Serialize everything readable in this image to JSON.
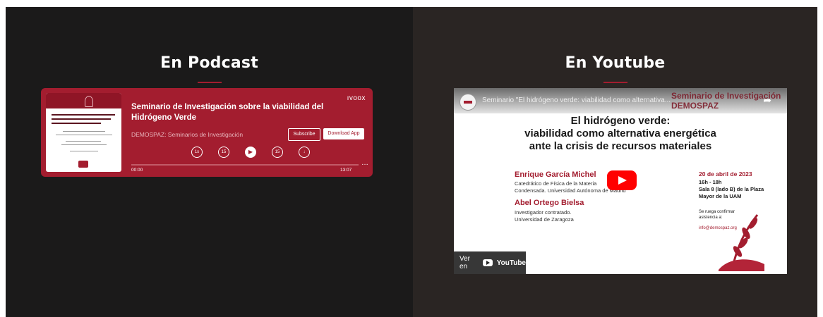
{
  "podcast_section": {
    "heading": "En Podcast",
    "player": {
      "brand": "ıvoox",
      "title": "Seminario de Investigación sobre la viabilidad del Hidrógeno Verde",
      "channel": "DEMOSPAZ: Seminarios de Investigación",
      "subscribe_label": "Subscribe",
      "download_label": "Download App",
      "controls": [
        "1x",
        "15",
        "▶",
        "15",
        "↓"
      ],
      "time_start": "00:00",
      "time_end": "13:07",
      "progress": 0.0,
      "more_icon": "…"
    }
  },
  "youtube_section": {
    "heading": "En Youtube",
    "video": {
      "top_title": "Seminario \"El hidrógeno verde: viabilidad como alternativa...",
      "badge": "Seminario de Investigación DEMOSPAZ",
      "main_title_line1": "El hidrógeno verde:",
      "main_title_line2": "viabilidad como alternativa energética",
      "main_title_line3": "ante la crisis de recursos materiales",
      "speaker1_name": "Enrique García Michel",
      "speaker1_desc_line1": "Catedrático de Física de la Materia",
      "speaker1_desc_line2": "Condensada. Universidad Autónoma de Madrid",
      "speaker2_name": "Abel Ortego Bielsa",
      "speaker2_desc_line1": "Investigador contratado.",
      "speaker2_desc_line2": "Universidad de Zaragoza",
      "date": "20 de abril de 2023",
      "info_line1": "16h - 18h",
      "info_line2": "Sala 8 (lado B) de la Plaza",
      "info_line3": "Mayor de la UAM",
      "note_line1": "Se ruega confirmar",
      "note_line2": "asistencia a:",
      "email": "info@demospaz.org",
      "watch_on": "Ver en",
      "youtube_wordmark": "YouTube"
    }
  },
  "colors": {
    "accent": "#a31d2f",
    "left_bg": "#1b1a1a",
    "right_bg": "#2a2523",
    "youtube_red": "#ff0000"
  }
}
